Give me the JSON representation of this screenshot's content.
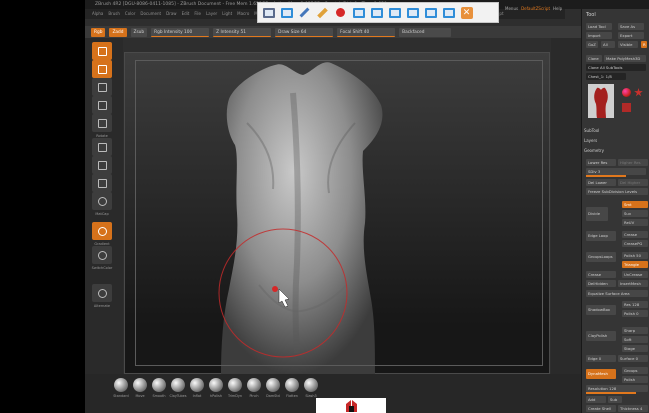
{
  "app": {
    "title": "ZBrush 4R2 [DGU-8086-0411-1085] - ZBrush Document - Free Mem 1.651GB - Active Mem 1.055GB - Scratch Disk 0 - Time 1.020",
    "menu": [
      "Alpha",
      "Brush",
      "Color",
      "Document",
      "Draw",
      "Edit",
      "File",
      "Layer",
      "Light",
      "Macro",
      "Marker",
      "Material",
      "Movie",
      "Picker",
      "Preferences",
      "Render",
      "Stencil",
      "Stroke",
      "Texture",
      "Tool",
      "Transform",
      "Zplugin",
      "Zscript"
    ],
    "top_right_links": [
      {
        "label": "Menus",
        "highlight": false
      },
      {
        "label": "DefaultZScript",
        "highlight": true
      },
      {
        "label": "Help",
        "highlight": false
      }
    ]
  },
  "overlay_toolbar": {
    "icons": [
      {
        "name": "select-icon",
        "color": "#5a6b8c"
      },
      {
        "name": "screen-icon",
        "color": "#2f8dd8"
      },
      {
        "name": "pen-icon",
        "color": "#4477bb"
      },
      {
        "name": "highlighter-icon",
        "color": "#e0a23a"
      },
      {
        "name": "record-icon",
        "color": "#d62828"
      },
      {
        "name": "window-icon",
        "color": "#2f8dd8"
      },
      {
        "name": "arrow-window-icon",
        "color": "#2f8dd8"
      },
      {
        "name": "zoom-window-icon",
        "color": "#2f8dd8"
      },
      {
        "name": "capture-icon",
        "color": "#2f8dd8"
      },
      {
        "name": "camera-icon",
        "color": "#2f8dd8"
      },
      {
        "name": "gallery-icon",
        "color": "#2f8dd8"
      },
      {
        "name": "close-icon",
        "color": "#e8913c"
      }
    ]
  },
  "controlbar": {
    "mrgb": "Rgb",
    "zadd": "Zadd",
    "zsub": "Zsub",
    "rgb_intensity": "Rgb Intensity 100",
    "z_intensity": "Z Intensity 51",
    "draw_size": "Draw Size 64",
    "focal_shift": "Focal Shift 40",
    "backface": "Backfaced"
  },
  "left_shelf": [
    {
      "name": "draw-tool",
      "label": "Draw",
      "orange": true
    },
    {
      "name": "edit-tool",
      "label": "Edit",
      "orange": true
    },
    {
      "name": "move-tool",
      "label": "Move",
      "orange": false
    },
    {
      "name": "scale-tool",
      "label": "Scale",
      "orange": false
    },
    {
      "name": "rotate-tool",
      "label": "Rotate",
      "orange": false
    },
    {
      "name": "dots-stroke",
      "label": "Dots",
      "orange": false
    },
    {
      "name": "alpha-off",
      "label": "Alpha Off",
      "orange": false
    },
    {
      "name": "texture-off",
      "label": "Texture Off",
      "orange": false
    },
    {
      "name": "material-matcap",
      "label": "MatCap",
      "orange": false
    },
    {
      "name": "gradient-swatch",
      "label": "Gradient",
      "orange": true
    },
    {
      "name": "switch-color",
      "label": "SwitchColor",
      "orange": false
    },
    {
      "name": "alternate",
      "label": "Alternate",
      "orange": false
    }
  ],
  "brushes": [
    "Standard",
    "Move",
    "Smooth",
    "ClayTubes",
    "Inflat",
    "hPolish",
    "TrimDyn",
    "Pinch",
    "DamStd",
    "Flatten",
    "Slash3"
  ],
  "tool_panel": {
    "title": "Tool",
    "buttons": {
      "load_tool": "Load Tool",
      "save_as": "Save As",
      "import": "Import",
      "export": "Export",
      "clone": "Clone",
      "make_polymesh": "Make PolyMesh3D",
      "goz": "GoZ",
      "all": "All",
      "visible": "Visible",
      "r": "R"
    },
    "lightbox": "Lightbox",
    "tool_name": "Clone All SubTools",
    "count": "Chest_1: 1/8",
    "sections": [
      "SubTool",
      "Layers",
      "Geometry"
    ],
    "geometry": {
      "lower_res": "Lower Res",
      "higher_res": "Higher Res",
      "sdiv": "SDiv 3",
      "del_lower": "Del Lower",
      "del_higher": "Del Higher",
      "freeze": "Freeze SubDivision Levels",
      "divide": "Divide",
      "smt": "Smt",
      "suv": "Suv",
      "reuv": "ReUV",
      "edge_loop": "Edge Loop",
      "crease": "Crease",
      "creasepg": "CreasePG",
      "groups_loops": "GroupsLoops",
      "polish": "Polish 50",
      "triangle": "Triangle",
      "crease2": "Crease",
      "uncrease": "UnCrease",
      "del_hidden": "DelHidden",
      "insert_mesh": "InsertMesh",
      "equalize": "Equalize Surface Area",
      "shadowbox": "ShadowBox",
      "res": "Res 128",
      "polish2": "Polish 0",
      "claypolish": "ClayPolish",
      "sharp": "Sharp",
      "soft": "Soft",
      "stage": "Stage",
      "edge": "Edge 0",
      "surface": "Surface 0"
    },
    "dynamesh": {
      "label": "DynaMesh",
      "groups": "Groups",
      "polish": "Polish",
      "resolution": "Resolution 128"
    },
    "footer": {
      "add": "Add",
      "sub": "Sub",
      "create_shell": "Create Shell",
      "thickness": "Thickness 4"
    }
  },
  "colors": {
    "accent": "#e1781d",
    "panel": "#353535",
    "canvas_bg": "#262626",
    "brush_ring": "#c42a2a"
  }
}
